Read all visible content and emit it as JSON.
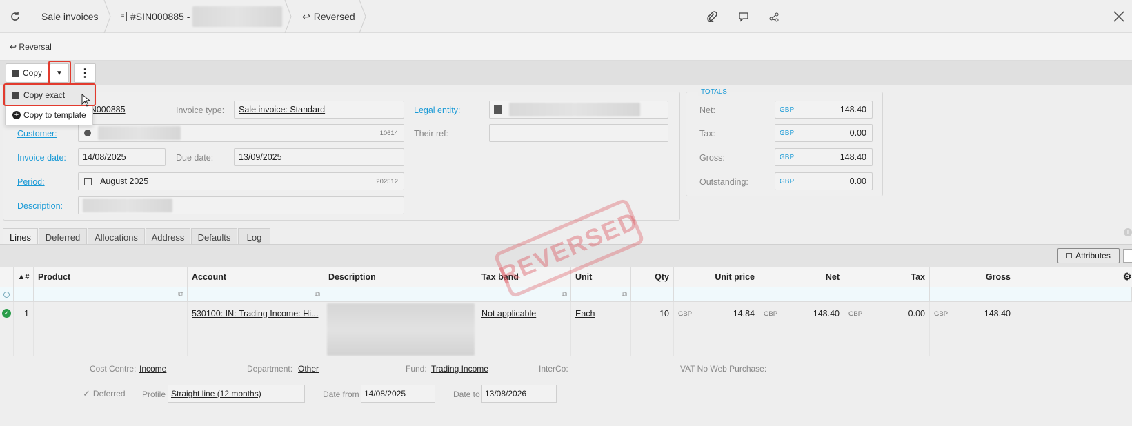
{
  "header": {
    "breadcrumb_1": "Sale invoices",
    "breadcrumb_2": "#SIN000885 -",
    "breadcrumb_3": "Reversed"
  },
  "subbar": {
    "label": "Reversal"
  },
  "toolbar": {
    "copy_label": "Copy"
  },
  "dropdown": {
    "item_1": "Copy exact",
    "item_2": "Copy to template"
  },
  "form": {
    "number_value": "SIN000885",
    "invoice_type_label": "Invoice type:",
    "invoice_type_value": "Sale invoice: Standard",
    "legal_entity_label": "Legal entity:",
    "customer_label": "Customer:",
    "customer_code": "10614",
    "their_ref_label": "Their ref:",
    "invoice_date_label": "Invoice date:",
    "invoice_date_value": "14/08/2025",
    "due_date_label": "Due date:",
    "due_date_value": "13/09/2025",
    "period_label": "Period:",
    "period_value": "August 2025",
    "period_code": "202512",
    "description_label": "Description:"
  },
  "totals": {
    "title": "TOTALS",
    "currency": "GBP",
    "net_label": "Net:",
    "net_value": "148.40",
    "tax_label": "Tax:",
    "tax_value": "0.00",
    "gross_label": "Gross:",
    "gross_value": "148.40",
    "outstanding_label": "Outstanding:",
    "outstanding_value": "0.00"
  },
  "stamp": "REVERSED",
  "tabs": [
    "Lines",
    "Deferred",
    "Allocations",
    "Address",
    "Defaults",
    "Log"
  ],
  "grid": {
    "attributes_label": "Attributes",
    "columns": [
      "▲#",
      "Product",
      "Account",
      "Description",
      "Tax band",
      "Unit",
      "Qty",
      "Unit price",
      "Net",
      "Tax",
      "Gross"
    ],
    "row": {
      "num": "1",
      "product": "-",
      "account": "530100: IN: Trading Income: Hi...",
      "tax_band": "Not applicable",
      "unit": "Each",
      "qty": "10",
      "currency": "GBP",
      "unit_price": "14.84",
      "net": "148.40",
      "tax": "0.00",
      "gross": "148.40"
    }
  },
  "footer": {
    "cost_centre_label": "Cost Centre:",
    "cost_centre_value": "Income",
    "department_label": "Department:",
    "department_value": "Other",
    "fund_label": "Fund:",
    "fund_value": "Trading Income",
    "interco_label": "InterCo:",
    "vat_label": "VAT No Web Purchase:",
    "deferred_label": "Deferred",
    "profile_label": "Profile",
    "profile_value": "Straight line (12 months)",
    "date_from_label": "Date from",
    "date_from_value": "14/08/2025",
    "date_to_label": "Date to",
    "date_to_value": "13/08/2026"
  }
}
